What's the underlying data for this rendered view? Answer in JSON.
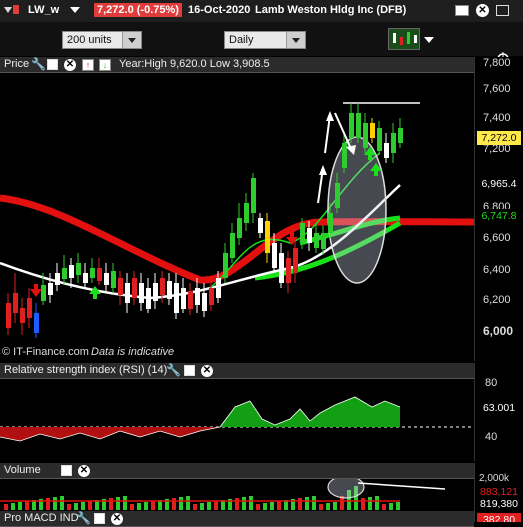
{
  "header": {
    "symbol": "LW_w",
    "price_badge": "7,272.0 (-0.75%)",
    "date": "16-Oct-2020",
    "instrument": "Lamb Weston Hldg Inc (DFB)",
    "colors": {
      "badge": "#e03c3c",
      "text": "#ffffff"
    }
  },
  "controls": {
    "units_value": "200 units",
    "interval_value": "Daily",
    "icons": [
      "chart-type-icon",
      "crosshair-icon",
      "hamburger-menu-icon"
    ]
  },
  "price_panel": {
    "title": "Price",
    "info": "Year:High 9,620.0 Low 3,908.5",
    "footer_brand": "© IT-Finance.com",
    "footer_note": "Data is indicative",
    "axis_ticks": [
      "7,800",
      "7,600",
      "7,400",
      "7,200",
      "6,800",
      "6,600",
      "6,400",
      "6,200",
      "6,000"
    ],
    "tags": {
      "last": "7,272.0",
      "ma_white": "6,965.4",
      "ma_green": "6,747.8"
    },
    "colors": {
      "up": "#2ecc2e",
      "down": "#e02020",
      "ma_red": "#e31010",
      "ma_green": "#19e019",
      "ma_white": "#ffffff"
    }
  },
  "rsi_panel": {
    "title": "Relative strength index (RSI) (14)",
    "axis_ticks": [
      "80",
      "40"
    ],
    "value_tag": "63.001"
  },
  "volume_panel": {
    "title": "Volume",
    "axis_ticks": [
      "2,000k"
    ],
    "tags": {
      "top": "883,121",
      "bottom": "819,380"
    }
  },
  "macd_panel": {
    "title": "Pro MACD IND",
    "tag": "382.80"
  }
}
